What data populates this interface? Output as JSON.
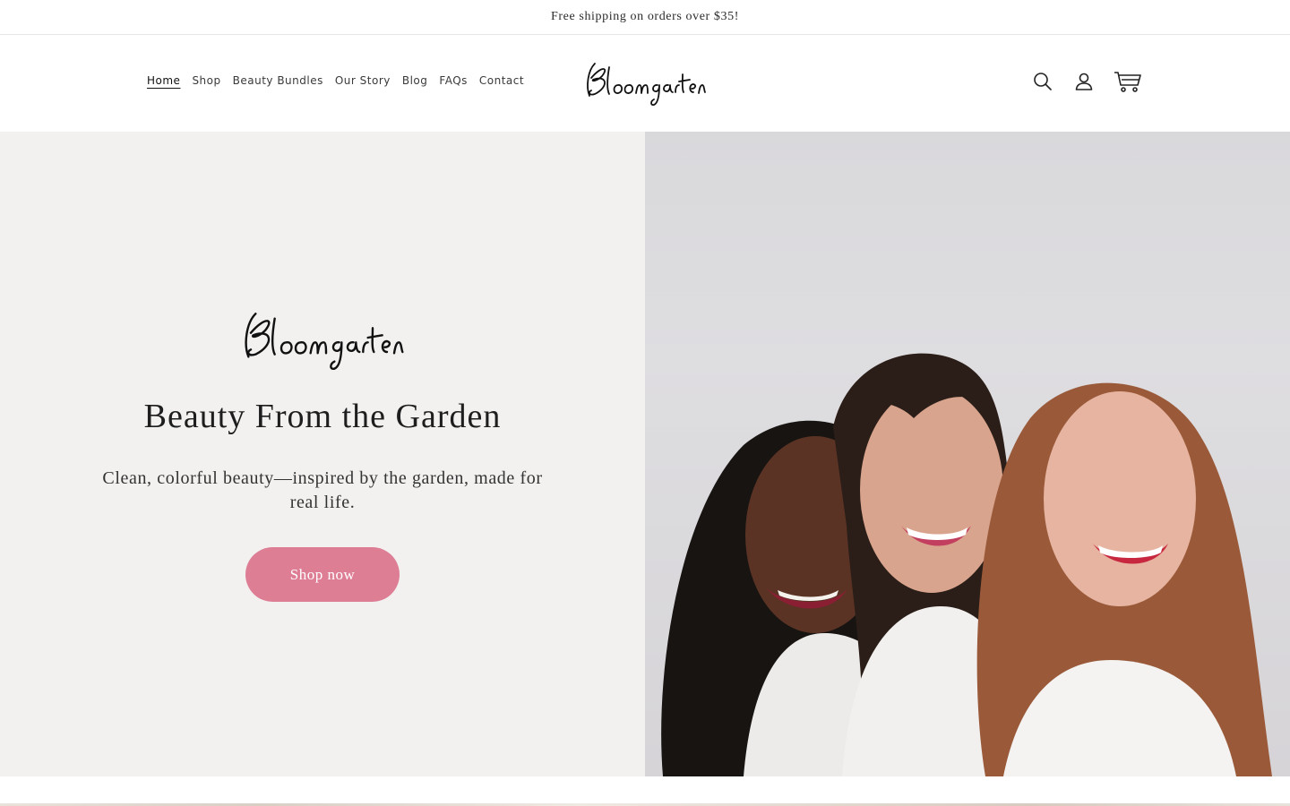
{
  "announcement": "Free shipping on orders over $35!",
  "brand": {
    "name": "Bloomgarten",
    "accent": "#dd7e95"
  },
  "nav": {
    "items": [
      {
        "label": "Home",
        "active": true
      },
      {
        "label": "Shop"
      },
      {
        "label": "Beauty Bundles"
      },
      {
        "label": "Our Story"
      },
      {
        "label": "Blog"
      },
      {
        "label": "FAQs"
      },
      {
        "label": "Contact"
      }
    ]
  },
  "header_icons": [
    "search-icon",
    "account-icon",
    "cart-icon"
  ],
  "hero": {
    "title": "Beauty From the Garden",
    "subtitle": "Clean, colorful beauty—inspired by the garden, made for real life.",
    "button": "Shop now",
    "image_subject": "hero-photo-three-women"
  }
}
